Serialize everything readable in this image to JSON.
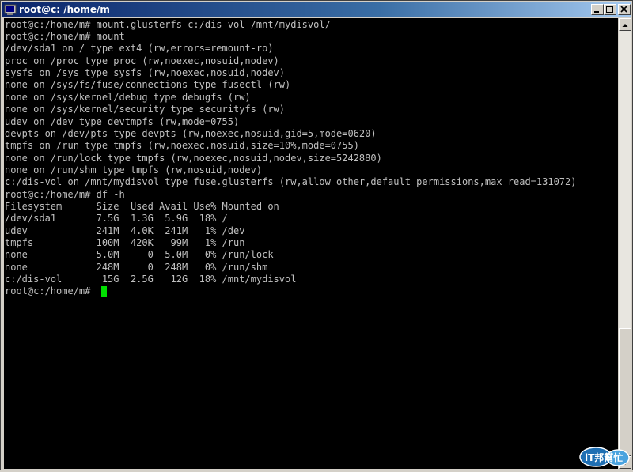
{
  "window": {
    "title": "root@c: /home/m"
  },
  "terminal": {
    "lines": [
      "root@c:/home/m# mount.glusterfs c:/dis-vol /mnt/mydisvol/",
      "root@c:/home/m# mount",
      "/dev/sda1 on / type ext4 (rw,errors=remount-ro)",
      "proc on /proc type proc (rw,noexec,nosuid,nodev)",
      "sysfs on /sys type sysfs (rw,noexec,nosuid,nodev)",
      "none on /sys/fs/fuse/connections type fusectl (rw)",
      "none on /sys/kernel/debug type debugfs (rw)",
      "none on /sys/kernel/security type securityfs (rw)",
      "udev on /dev type devtmpfs (rw,mode=0755)",
      "devpts on /dev/pts type devpts (rw,noexec,nosuid,gid=5,mode=0620)",
      "tmpfs on /run type tmpfs (rw,noexec,nosuid,size=10%,mode=0755)",
      "none on /run/lock type tmpfs (rw,noexec,nosuid,nodev,size=5242880)",
      "none on /run/shm type tmpfs (rw,nosuid,nodev)",
      "c:/dis-vol on /mnt/mydisvol type fuse.glusterfs (rw,allow_other,default_permissions,max_read=131072)",
      "root@c:/home/m# df -h",
      "Filesystem      Size  Used Avail Use% Mounted on",
      "/dev/sda1       7.5G  1.3G  5.9G  18% /",
      "udev            241M  4.0K  241M   1% /dev",
      "tmpfs           100M  420K   99M   1% /run",
      "none            5.0M     0  5.0M   0% /run/lock",
      "none            248M     0  248M   0% /run/shm",
      "c:/dis-vol       15G  2.5G   12G  18% /mnt/mydisvol",
      "root@c:/home/m# "
    ]
  },
  "watermark": {
    "text": "iT邦幫忙"
  },
  "colors": {
    "terminal_bg": "#000000",
    "terminal_fg": "#c0c0c0",
    "cursor": "#00e000",
    "titlebar": "#0a246a"
  }
}
